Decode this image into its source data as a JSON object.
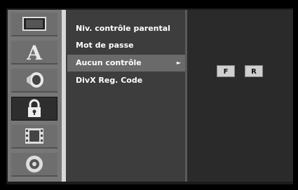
{
  "icons": [
    "picture-icon",
    "language-icon",
    "audio-icon",
    "lock-icon",
    "film-icon",
    "disc-icon"
  ],
  "menu": {
    "items": [
      {
        "label": "Niv. contrôle parental",
        "selected": false
      },
      {
        "label": "Mot de passe",
        "selected": false
      },
      {
        "label": "Aucun contrôle",
        "selected": true,
        "arrow": "►"
      },
      {
        "label": "DivX Reg. Code",
        "selected": false
      }
    ]
  },
  "options": {
    "f_label": "F",
    "r_label": "R"
  }
}
